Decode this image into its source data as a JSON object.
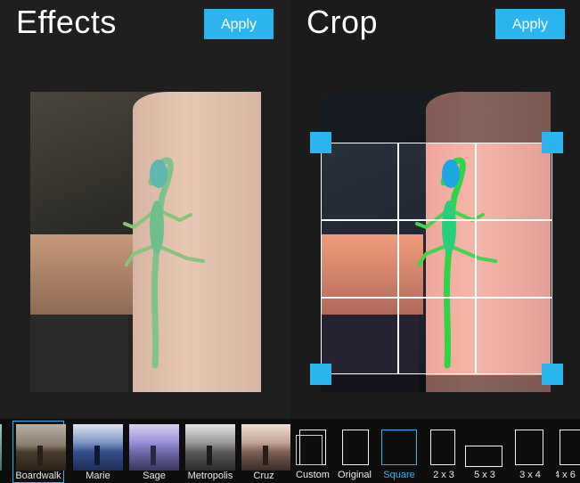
{
  "effects_panel": {
    "title": "Effects",
    "apply_label": "Apply",
    "filters": [
      {
        "label": "",
        "selected": false
      },
      {
        "label": "Boardwalk",
        "selected": true
      },
      {
        "label": "Marie",
        "selected": false
      },
      {
        "label": "Sage",
        "selected": false
      },
      {
        "label": "Metropolis",
        "selected": false
      },
      {
        "label": "Cruz",
        "selected": false
      }
    ]
  },
  "crop_panel": {
    "title": "Crop",
    "apply_label": "Apply",
    "options": [
      {
        "label": "Custom",
        "selected": false
      },
      {
        "label": "Original",
        "selected": false
      },
      {
        "label": "Square",
        "selected": true
      },
      {
        "label": "2 x 3",
        "selected": false
      },
      {
        "label": "5 x 3",
        "selected": false
      },
      {
        "label": "3 x 4",
        "selected": false
      },
      {
        "label": "4 x 6",
        "selected": false
      }
    ]
  },
  "colors": {
    "accent": "#2bb5ee",
    "background": "#1f1f1f",
    "strip": "#0e0e0e",
    "selected_label": "#2bb5ee"
  }
}
